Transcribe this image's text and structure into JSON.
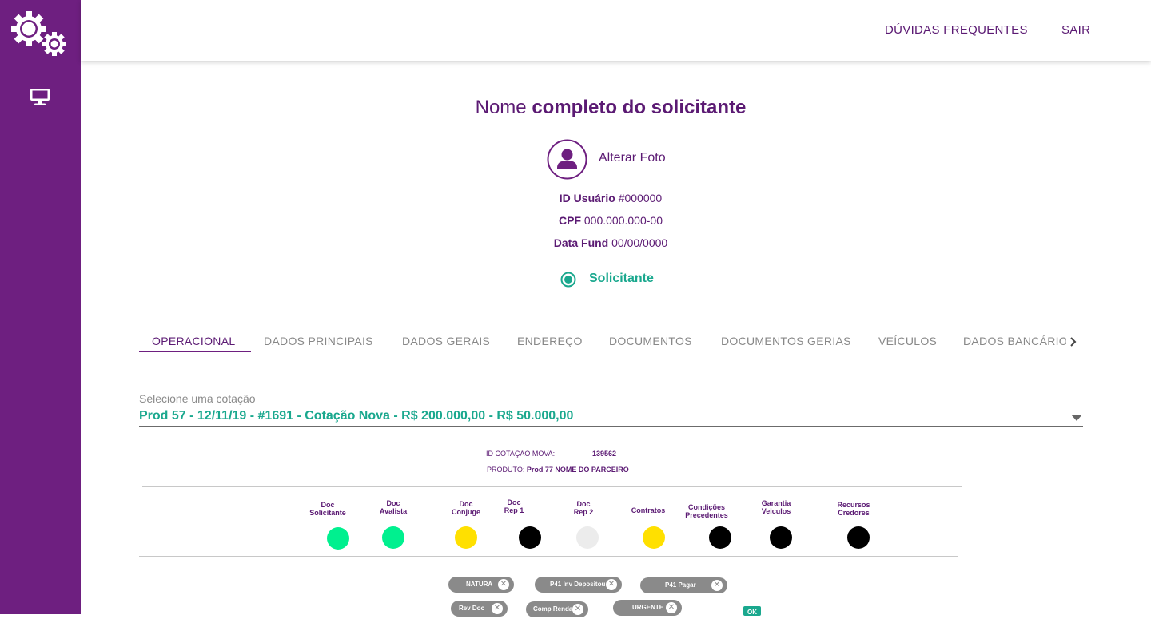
{
  "topnav": {
    "faq": "DÚVIDAS FREQUENTES",
    "logout": "SAIR"
  },
  "header": {
    "name_light": "Nome",
    "name_bold": "completo do solicitante"
  },
  "profile": {
    "change_photo": "Alterar Foto",
    "user_id_label": "ID Usuário",
    "user_id_value": "#000000",
    "cpf_label": "CPF",
    "cpf_value": "000.000.000-00",
    "date_label": "Data Fund",
    "date_value": "00/00/0000",
    "role": "Solicitante"
  },
  "tabs": [
    {
      "label": "OPERACIONAL"
    },
    {
      "label": "DADOS PRINCIPAIS"
    },
    {
      "label": "DADOS GERAIS"
    },
    {
      "label": "ENDEREÇO"
    },
    {
      "label": "DOCUMENTOS"
    },
    {
      "label": "DOCUMENTOS GERIAS"
    },
    {
      "label": "VEÍCULOS"
    },
    {
      "label": "DADOS BANCÁRIOS"
    }
  ],
  "quote": {
    "label": "Selecione uma cotação",
    "value": "Prod 57 - 12/11/19 - #1691 - Cotação Nova - R$ 200.000,00 - R$ 50.000,00",
    "id_label": "ID COTAÇÃO MOVA:",
    "id_value": "139562",
    "product_label": "PRODUTO:",
    "product_value": "Prod 77 NOME DO PARCEIRO"
  },
  "steps": [
    {
      "l1": "Doc",
      "l2": "Solicitante",
      "status_color": "#00f08f"
    },
    {
      "l1": "Doc",
      "l2": "Avalista",
      "status_color": "#00f08f"
    },
    {
      "l1": "Doc",
      "l2": "Conjuge",
      "status_color": "#ffe000"
    },
    {
      "l1": "Doc",
      "l2": "Rep 1",
      "status_color": "#000000"
    },
    {
      "l1": "Doc",
      "l2": "Rep 2",
      "status_color": "#ececec"
    },
    {
      "l1": "Contratos",
      "l2": "",
      "status_color": "#ffe000"
    },
    {
      "l1": "Condições",
      "l2": "Precedentes",
      "status_color": "#000000"
    },
    {
      "l1": "Garantia",
      "l2": "Veiculos",
      "status_color": "#000000"
    },
    {
      "l1": "Recursos",
      "l2": "Credores",
      "status_color": "#000000"
    }
  ],
  "chips": [
    {
      "label": "NATURA"
    },
    {
      "label": "P41 Inv Depositou"
    },
    {
      "label": "P41 Pagar"
    },
    {
      "label": "Rev Doc"
    },
    {
      "label": "Comp Renda"
    },
    {
      "label": "URGENTE"
    }
  ],
  "chip_remove_glyph": "✕",
  "ok_label": "OK",
  "colors": {
    "brand": "#6e1f80",
    "accent": "#1aa88e"
  }
}
